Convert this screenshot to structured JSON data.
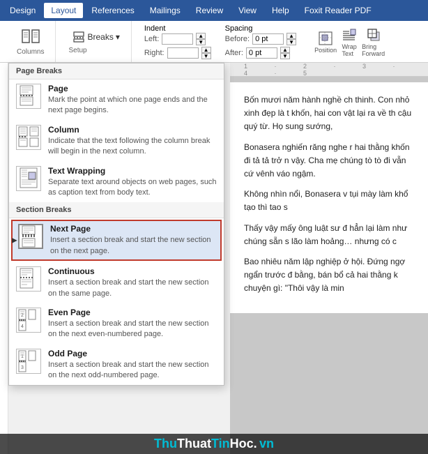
{
  "ribbon": {
    "tabs": [
      "Design",
      "Layout",
      "References",
      "Mailings",
      "Review",
      "View",
      "Help",
      "Foxit Reader PDF"
    ],
    "active_tab": "Layout"
  },
  "toolbar": {
    "breaks_label": "Breaks",
    "indent_label": "Indent",
    "spacing_label": "Spacing",
    "left_label": "Left:",
    "right_label": "Right:",
    "before_label": "Before:",
    "after_label": "After:",
    "left_val": "",
    "right_val": "",
    "before_val": "0 pt",
    "after_val": "0 pt",
    "columns_label": "Columns",
    "setup_label": "Setup"
  },
  "menu": {
    "page_breaks_header": "Page Breaks",
    "section_breaks_header": "Section Breaks",
    "items": [
      {
        "id": "page",
        "title": "Page",
        "desc": "Mark the point at which one page ends and the next page begins.",
        "highlighted": false
      },
      {
        "id": "column",
        "title": "Column",
        "desc": "Indicate that the text following the column break will begin in the next column.",
        "highlighted": false
      },
      {
        "id": "text-wrapping",
        "title": "Text Wrapping",
        "desc": "Separate text around objects on web pages, such as caption text from body text.",
        "highlighted": false
      },
      {
        "id": "next-page",
        "title": "Next Page",
        "desc": "Insert a section break and start the new section on the next page.",
        "highlighted": true
      },
      {
        "id": "continuous",
        "title": "Continuous",
        "desc": "Insert a section break and start the new section on the same page.",
        "highlighted": false
      },
      {
        "id": "even-page",
        "title": "Even Page",
        "desc": "Insert a section break and start the new section on the next even-numbered page.",
        "highlighted": false
      },
      {
        "id": "odd-page",
        "title": "Odd Page",
        "desc": "Insert a section break and start the new section on the next odd-numbered page.",
        "highlighted": false
      }
    ]
  },
  "document": {
    "paragraphs": [
      "Bốn mươi năm hành nghề ch thinh. Con nhỏ xinh đẹp là t khốn, hai con vật lại ra về th cậu quý từ. Họ sung sướng,",
      "Bonasera nghiến răng nghe r hai thằng khốn đi tả tả trở n vậy. Cha mẹ chúng tò tò đi vẫn cứ vênh váo ngậm.",
      "Không nhìn nổi, Bonasera v tụi mày làm khổ tạo thì tao s",
      "Thấy vậy mấy ông luật sư đ hẳn lại làm như chúng sẵn s lão làm hoảng… nhưng có c",
      "Bao nhiêu năm lập nghiệp ở hội. Đứng ngợ ngẩn trước đ bằng, bán bổ cả hai thằng k chuyện gì: \"Thôi vậy là min"
    ]
  },
  "watermark": {
    "text": "ThuThuatTinHoc. vn"
  }
}
